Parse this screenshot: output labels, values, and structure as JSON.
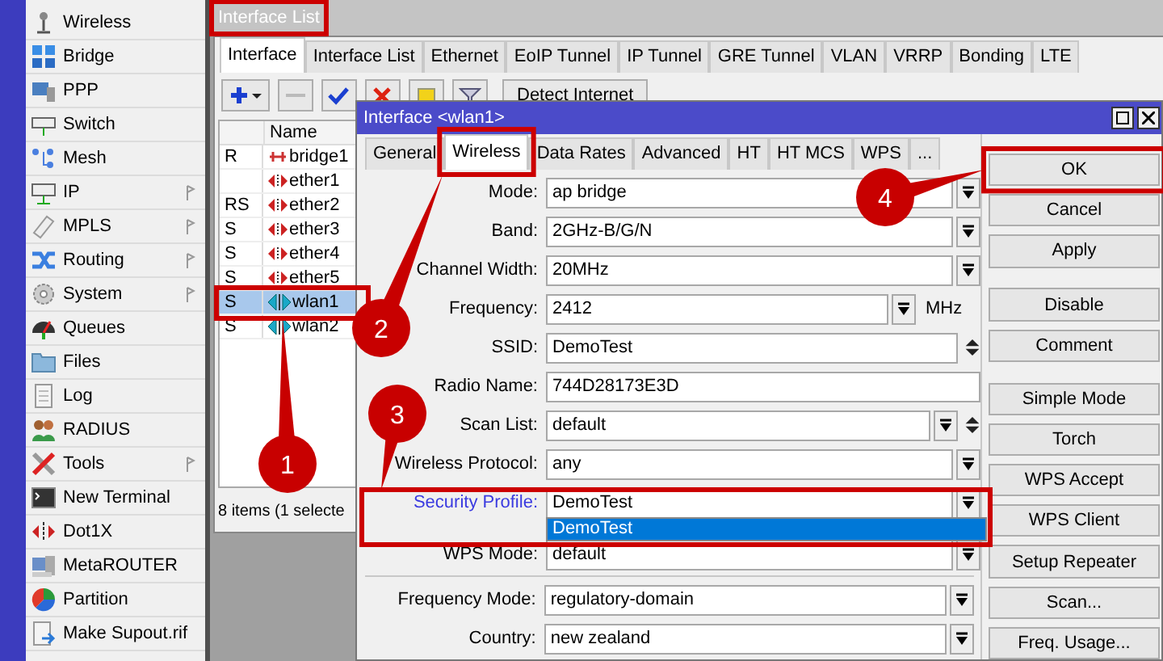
{
  "sidebar": {
    "items": [
      {
        "label": "Wireless",
        "submenu": false
      },
      {
        "label": "Bridge",
        "submenu": false
      },
      {
        "label": "PPP",
        "submenu": false
      },
      {
        "label": "Switch",
        "submenu": false
      },
      {
        "label": "Mesh",
        "submenu": false
      },
      {
        "label": "IP",
        "submenu": true
      },
      {
        "label": "MPLS",
        "submenu": true
      },
      {
        "label": "Routing",
        "submenu": true
      },
      {
        "label": "System",
        "submenu": true
      },
      {
        "label": "Queues",
        "submenu": false
      },
      {
        "label": "Files",
        "submenu": false
      },
      {
        "label": "Log",
        "submenu": false
      },
      {
        "label": "RADIUS",
        "submenu": false
      },
      {
        "label": "Tools",
        "submenu": true
      },
      {
        "label": "New Terminal",
        "submenu": false
      },
      {
        "label": "Dot1X",
        "submenu": false
      },
      {
        "label": "MetaROUTER",
        "submenu": false
      },
      {
        "label": "Partition",
        "submenu": false
      },
      {
        "label": "Make Supout.rif",
        "submenu": false
      }
    ]
  },
  "interface_list": {
    "title": "Interface List",
    "tabs": [
      {
        "label": "Interface",
        "selected": true
      },
      {
        "label": "Interface List",
        "selected": false
      },
      {
        "label": "Ethernet",
        "selected": false
      },
      {
        "label": "EoIP Tunnel",
        "selected": false
      },
      {
        "label": "IP Tunnel",
        "selected": false
      },
      {
        "label": "GRE Tunnel",
        "selected": false
      },
      {
        "label": "VLAN",
        "selected": false
      },
      {
        "label": "VRRP",
        "selected": false
      },
      {
        "label": "Bonding",
        "selected": false
      },
      {
        "label": "LTE",
        "selected": false
      }
    ],
    "detect_button": "Detect Internet",
    "table": {
      "columns": [
        "Name"
      ],
      "rows": [
        {
          "flags": "R",
          "name": "bridge1",
          "kind": "bridge",
          "selected": false
        },
        {
          "name": "ether1",
          "kind": "ethernet",
          "selected": false
        },
        {
          "flags": "RS",
          "name": "ether2",
          "kind": "ethernet",
          "selected": false
        },
        {
          "flags": "S",
          "name": "ether3",
          "kind": "ethernet",
          "selected": false
        },
        {
          "flags": "S",
          "name": "ether4",
          "kind": "ethernet",
          "selected": false
        },
        {
          "flags": "S",
          "name": "ether5",
          "kind": "ethernet",
          "selected": false
        },
        {
          "flags": "S",
          "name": "wlan1",
          "kind": "wireless",
          "selected": true
        },
        {
          "flags": "S",
          "name": "wlan2",
          "kind": "wireless",
          "selected": false
        }
      ]
    },
    "status": "8 items (1 selecte"
  },
  "dialog": {
    "title": "Interface <wlan1>",
    "tabs": [
      {
        "label": "General",
        "selected": false
      },
      {
        "label": "Wireless",
        "selected": true
      },
      {
        "label": "Data Rates",
        "selected": false
      },
      {
        "label": "Advanced",
        "selected": false
      },
      {
        "label": "HT",
        "selected": false
      },
      {
        "label": "HT MCS",
        "selected": false
      },
      {
        "label": "WPS",
        "selected": false
      },
      {
        "label": "...",
        "selected": false
      }
    ],
    "sections": [
      {
        "fields": [
          {
            "label": "Mode:",
            "value": "ap bridge",
            "kind": "dropdown",
            "highlighted": false
          },
          {
            "label": "Band:",
            "value": "2GHz-B/G/N",
            "kind": "dropdown",
            "highlighted": false
          },
          {
            "label": "Channel Width:",
            "value": "20MHz",
            "kind": "dropdown",
            "highlighted": false
          },
          {
            "label": "Frequency:",
            "value": "2412",
            "kind": "dropdown_unit",
            "unit": "MHz",
            "highlighted": false
          },
          {
            "label": "SSID:",
            "value": "DemoTest",
            "kind": "text_updown",
            "highlighted": false
          },
          {
            "label": "Radio Name:",
            "value": "744D28173E3D",
            "kind": "text",
            "highlighted": false
          },
          {
            "label": "Scan List:",
            "value": "default",
            "kind": "dropdown_updown",
            "highlighted": false
          },
          {
            "label": "Wireless Protocol:",
            "value": "any",
            "kind": "dropdown",
            "highlighted": false
          },
          {
            "label": "Security Profile:",
            "value": "DemoTest",
            "kind": "dropdown",
            "highlighted": true
          },
          {
            "label": "WPS Mode:",
            "value": "default",
            "kind": "dropdown",
            "highlighted": false
          }
        ]
      },
      {
        "fields": [
          {
            "label": "Frequency Mode:",
            "value": "regulatory-domain",
            "kind": "dropdown",
            "highlighted": false
          },
          {
            "label": "Country:",
            "value": "new zealand",
            "kind": "dropdown",
            "highlighted": false
          }
        ]
      }
    ],
    "dropdown_list": {
      "options": [
        {
          "label": "DemoTest",
          "selected": true
        }
      ]
    },
    "buttons": [
      {
        "label": "OK",
        "gap_before": false
      },
      {
        "label": "Cancel",
        "gap_before": false
      },
      {
        "label": "Apply",
        "gap_before": false
      },
      {
        "label": "Disable",
        "gap_before": true
      },
      {
        "label": "Comment",
        "gap_before": false
      },
      {
        "label": "Simple Mode",
        "gap_before": true
      },
      {
        "label": "Torch",
        "gap_before": false
      },
      {
        "label": "WPS Accept",
        "gap_before": false
      },
      {
        "label": "WPS Client",
        "gap_before": false
      },
      {
        "label": "Setup Repeater",
        "gap_before": false
      },
      {
        "label": "Scan...",
        "gap_before": false
      },
      {
        "label": "Freq. Usage...",
        "gap_before": false
      }
    ]
  },
  "annotations": [
    {
      "number": "1"
    },
    {
      "number": "2"
    },
    {
      "number": "3"
    },
    {
      "number": "4"
    }
  ]
}
